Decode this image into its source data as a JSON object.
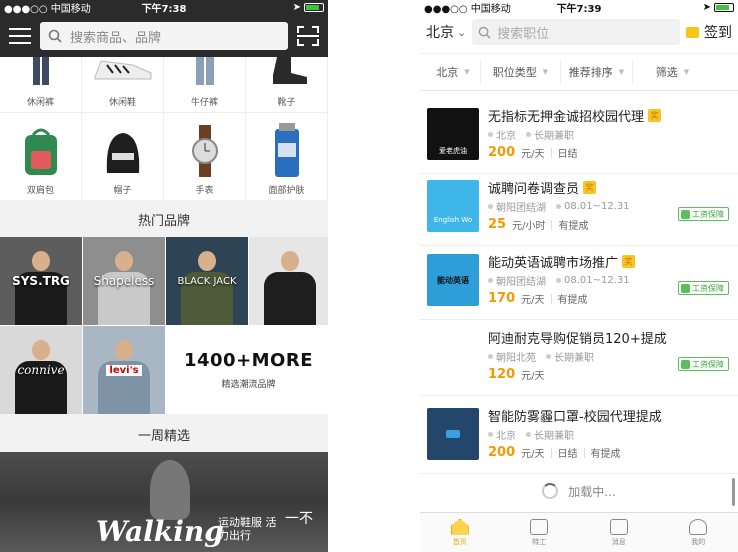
{
  "left": {
    "status": {
      "carrier": "●●●○○ 中国移动",
      "time": "下午7:38"
    },
    "search": {
      "placeholder": "搜索商品、品牌"
    },
    "categories_row1": [
      "休闲裤",
      "休闲鞋",
      "牛仔裤",
      "靴子"
    ],
    "categories_row2": [
      "双肩包",
      "帽子",
      "手表",
      "面部护肤"
    ],
    "brands_section_title": "热门品牌",
    "brand_labels": [
      "SYS.TRG",
      "Shapeless",
      "BLACK JACK",
      "",
      "connive",
      "levi's"
    ],
    "more_brands": {
      "count": "1400+MORE",
      "subtitle": "精选潮流品牌"
    },
    "weekly_title": "一周精选",
    "banner": {
      "word": "Walking",
      "cn": "运动鞋服 活力出行",
      "extra": "一不"
    }
  },
  "right": {
    "status": {
      "carrier": "●●●○○ 中国移动",
      "time": "下午7:39"
    },
    "city": "北京",
    "search": {
      "placeholder": "搜索职位"
    },
    "checkin": "签到",
    "filters": [
      "北京",
      "职位类型",
      "推荐排序",
      "筛选"
    ],
    "jobs": [
      {
        "title": "无指标无押金诚招校园代理",
        "tag": "奖",
        "location": "北京",
        "type": "长期兼职",
        "date": "",
        "amount": "200",
        "unit": "元/天",
        "settle": "日结",
        "extra": "",
        "guarantee": "",
        "logo_text": "爱老虎油"
      },
      {
        "title": "诚聘问卷调查员",
        "tag": "奖",
        "location": "朝阳团结湖",
        "type": "",
        "date": "08.01~12.31",
        "amount": "25",
        "unit": "元/小时",
        "settle": "有提成",
        "extra": "",
        "guarantee": "工资保障",
        "logo_text": "English Wo"
      },
      {
        "title": "能动英语诚聘市场推广",
        "tag": "奖",
        "location": "朝阳团结湖",
        "type": "",
        "date": "08.01~12.31",
        "amount": "170",
        "unit": "元/天",
        "settle": "有提成",
        "extra": "",
        "guarantee": "工资保障",
        "logo_text": "能动英语"
      },
      {
        "title": "阿迪耐克导购促销员120+提成",
        "tag": "",
        "location": "朝阳北苑",
        "type": "长期兼职",
        "date": "",
        "amount": "120",
        "unit": "元/天",
        "settle": "",
        "extra": "",
        "guarantee": "工资保障",
        "logo_text": ""
      },
      {
        "title": "智能防雾霾口罩-校园代理提成",
        "tag": "",
        "location": "北京",
        "type": "长期兼职",
        "date": "",
        "amount": "200",
        "unit": "元/天",
        "settle": "日结",
        "extra": "有提成",
        "guarantee": "",
        "logo_text": ""
      }
    ],
    "loading": "加载中...",
    "tabs": [
      "首页",
      "特工",
      "消息",
      "我的"
    ]
  }
}
